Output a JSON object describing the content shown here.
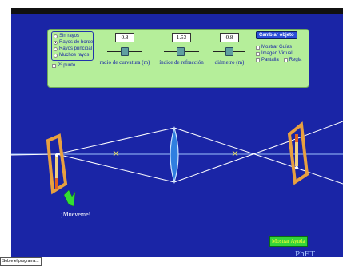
{
  "rays": {
    "options": [
      {
        "label": "Sin rayos",
        "selected": false
      },
      {
        "label": "Rayos de borde",
        "selected": true
      },
      {
        "label": "Rayos principal",
        "selected": false
      },
      {
        "label": "Muchos rayos",
        "selected": false
      }
    ],
    "second_point_label": "2º punto"
  },
  "parameters": [
    {
      "value": "0.8",
      "label": "radio de curvatura (m)"
    },
    {
      "value": "1.53",
      "label": "índice de refracción"
    },
    {
      "value": "0.8",
      "label": "diámetro (m)"
    }
  ],
  "change_object_label": "Cambiar objeto",
  "checkboxes": {
    "guides": "Mostrar Guías",
    "virtual_image": "Imagen Virtual",
    "screen": "Pantalla",
    "ruler": "Regla"
  },
  "move_me_label": "¡Mueveme!",
  "show_help_label": "Mostrar Ayuda",
  "about_label": "Sobre el programa...",
  "logo_text": "PhET",
  "colors": {
    "background": "#1a25a6",
    "control_panel": "#b5ee9a",
    "frame": "#e8a040",
    "lens": "#6fb6ff",
    "rays": "#ffffff",
    "arrow": "#33dd33"
  }
}
